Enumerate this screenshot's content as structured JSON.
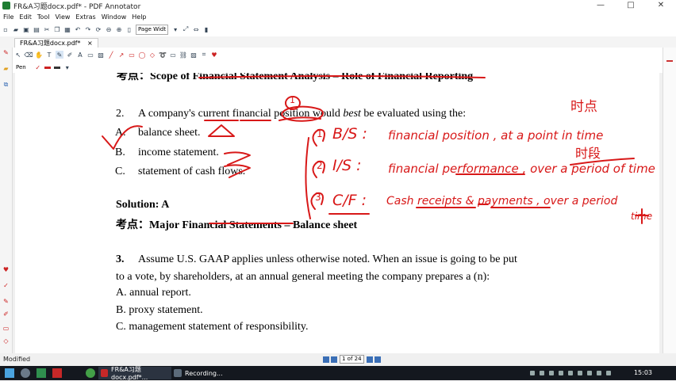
{
  "window": {
    "title": "FR&A习题docx.pdf* - PDF Annotator",
    "controls": [
      "—",
      "□",
      "✕"
    ]
  },
  "menu": [
    "File",
    "Edit",
    "Tool",
    "View",
    "Extras",
    "Window",
    "Help"
  ],
  "toolbar": {
    "zoom_value": "Page Widt"
  },
  "tab": {
    "label": "FR&A习题docx.pdf*",
    "close": "×"
  },
  "pen": {
    "label": "Pen"
  },
  "document": {
    "header_line": "考点：Scope of Financial Statement Analysis – Role of Financial Reporting",
    "q2": {
      "number": "2.",
      "text_a": "A company's current financial position would ",
      "text_best": "best",
      "text_b": " be evaluated using the:",
      "options": [
        {
          "letter": "A.",
          "text": "balance sheet."
        },
        {
          "letter": "B.",
          "text": "income statement."
        },
        {
          "letter": "C.",
          "text": "statement of cash flows."
        }
      ],
      "solution": "Solution: A",
      "kaodian_prefix": "考点：",
      "kaodian_bold": "Major Financial Statements",
      "kaodian_rest": " – Balance sheet"
    },
    "q3": {
      "number": "3.",
      "line1": "Assume U.S. GAAP applies unless otherwise noted. When an issue is going to be put",
      "line2": "to a vote, by shareholders, at an annual general meeting the company prepares a (n):",
      "options": [
        "A. annual report.",
        "B. proxy statement.",
        "C. management statement of responsibility."
      ]
    }
  },
  "annotations": {
    "circle_1": "1",
    "top_chinese": "时点",
    "mid_chinese": "时段",
    "bs_num": "1",
    "bs": "B/S :",
    "bs_note": "financial position ,  at a point  in time",
    "is_num": "2",
    "is": "I/S :",
    "is_note": "financial performance ,  over a period of time",
    "cf_num": "3",
    "cf": "C/F :",
    "cf_note": "Cash receipts & payments ,  over a period",
    "cf_note2": "time",
    "cf_plus": "+"
  },
  "pagebar": {
    "page_text": "1 of 24"
  },
  "status": {
    "text": "Modified"
  },
  "taskbar": {
    "tasks": [
      "FR&A习题docx.pdf*...",
      "Recording..."
    ],
    "clock": "15:03"
  },
  "colors": {
    "ink": "#d81818",
    "taskbar": "#14181f",
    "accent": "#3b6fb6"
  }
}
